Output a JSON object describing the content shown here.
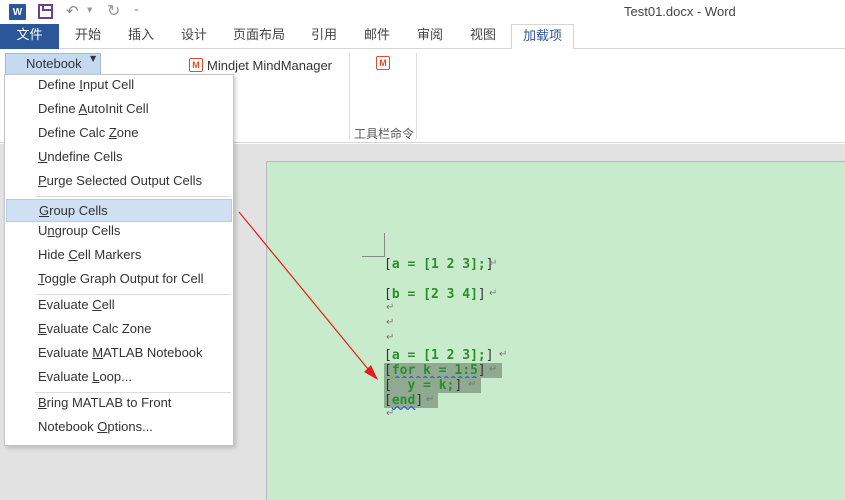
{
  "titlebar": {
    "app_icon": "word-icon",
    "title": "Test01.docx - Word"
  },
  "tabs": [
    {
      "label": "文件"
    },
    {
      "label": "开始"
    },
    {
      "label": "插入"
    },
    {
      "label": "设计"
    },
    {
      "label": "页面布局"
    },
    {
      "label": "引用"
    },
    {
      "label": "邮件"
    },
    {
      "label": "审阅"
    },
    {
      "label": "视图"
    },
    {
      "label": "加载项"
    }
  ],
  "ribbon": {
    "notebook_label": "Notebook",
    "mindmanager_label": "Mindjet MindManager",
    "mindjet_icon_letter": "M",
    "group_label": "工具栏命令"
  },
  "menu": {
    "items": [
      {
        "label": "Define Input Cell",
        "underline": "I"
      },
      {
        "label": "Define AutoInit Cell",
        "underline": "A"
      },
      {
        "label": "Define Calc Zone",
        "underline": "Z"
      },
      {
        "label": "Undefine Cells",
        "underline": "U"
      },
      {
        "label": "Purge Selected Output Cells",
        "underline": "P"
      },
      {
        "label": "Group Cells",
        "underline": "G",
        "highlighted": true
      },
      {
        "label": "Ungroup Cells",
        "underline": "n"
      },
      {
        "label": "Hide Cell Markers",
        "underline": "C"
      },
      {
        "label": "Toggle Graph Output for Cell",
        "underline": "T"
      },
      {
        "label": "Evaluate Cell",
        "underline": "C"
      },
      {
        "label": "Evaluate Calc Zone",
        "underline": "E"
      },
      {
        "label": "Evaluate MATLAB Notebook",
        "underline": "M"
      },
      {
        "label": "Evaluate Loop...",
        "underline": "L"
      },
      {
        "label": "Bring MATLAB to Front",
        "underline": "B"
      },
      {
        "label": "Notebook Options...",
        "underline": "O"
      }
    ]
  },
  "document": {
    "lines": [
      {
        "text": "a = [1 2 3];"
      },
      {
        "text": "b = [2 3 4]"
      },
      {
        "text": "a = [1 2 3];"
      },
      {
        "text": "for k = 1:5"
      },
      {
        "text": "  y = k;"
      },
      {
        "text": "end"
      }
    ],
    "paragraph_mark": "↵"
  },
  "colors": {
    "accent": "#2b579a",
    "page_background": "#c8ebcb",
    "code_text": "#2e8b2e",
    "group_highlight": "#8faa91",
    "arrow": "#e02020"
  }
}
